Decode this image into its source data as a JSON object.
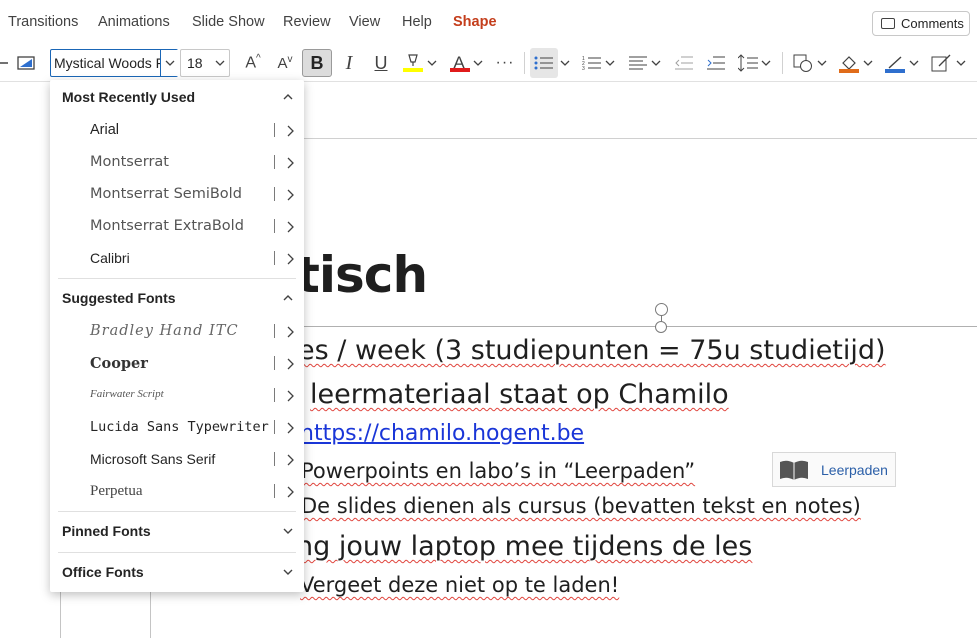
{
  "menubar": {
    "tabs": [
      "Transitions",
      "Animations",
      "Slide Show",
      "Review",
      "View",
      "Help",
      "Shape"
    ],
    "active_tab": "Shape",
    "comments_label": "Comments"
  },
  "ribbon": {
    "font_name": "Mystical Woods F",
    "font_size": "18",
    "bold_label": "B",
    "italic_label": "I",
    "underline_label": "U",
    "more_label": "···",
    "highlight_color": "#ffff00",
    "font_color": "#e01b1b",
    "fill_color": "#e06c1a",
    "outline_color": "#2e6fce"
  },
  "font_dropdown": {
    "sections": {
      "recent": {
        "title": "Most Recently Used",
        "items": [
          "Arial",
          "Montserrat",
          "Montserrat SemiBold",
          "Montserrat ExtraBold",
          "Calibri"
        ]
      },
      "suggested": {
        "title": "Suggested Fonts",
        "items": [
          "Bradley Hand ITC",
          "Cooper",
          "Fairwater Script",
          "Lucida Sans Typewriter",
          "Microsoft Sans Serif",
          "Perpetua"
        ]
      },
      "pinned": {
        "title": "Pinned Fonts"
      },
      "office": {
        "title": "Office Fonts"
      }
    }
  },
  "slide": {
    "title_fragment": "tisch",
    "line1": "es / week (3 studiepunten = 75u studietijd)",
    "line2": "leermateriaal staat op Chamilo",
    "line3": "https://chamilo.hogent.be",
    "line4": "Powerpoints en labo’s in “Leerpaden”",
    "line5": "De slides dienen als cursus (bevatten tekst en notes)",
    "line6": "ng jouw laptop mee tijdens de les",
    "line7": "Vergeet deze niet op te laden!",
    "leerpaden_label": "Leerpaden"
  }
}
